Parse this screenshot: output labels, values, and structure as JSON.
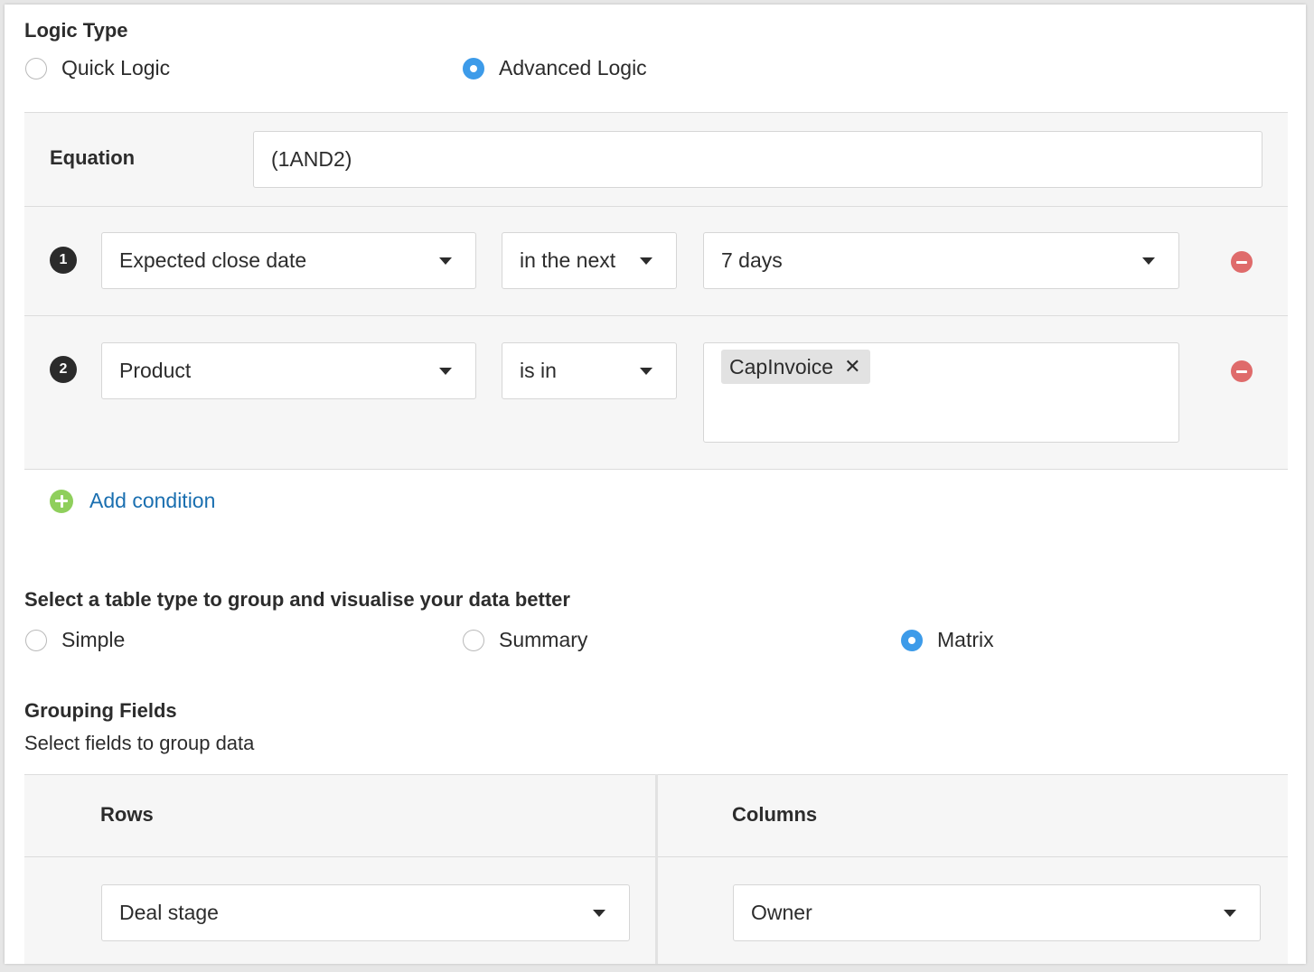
{
  "logic_type": {
    "heading": "Logic Type",
    "options": [
      {
        "label": "Quick Logic",
        "checked": false
      },
      {
        "label": "Advanced Logic",
        "checked": true
      }
    ]
  },
  "equation": {
    "label": "Equation",
    "value": "(1AND2)"
  },
  "conditions": [
    {
      "number": "1",
      "field": "Expected close date",
      "operator": "in the next",
      "value": "7 days"
    },
    {
      "number": "2",
      "field": "Product",
      "operator": "is in",
      "tags": [
        "CapInvoice"
      ]
    }
  ],
  "add_condition_label": "Add condition",
  "table_type": {
    "heading": "Select a table type to group and visualise your data better",
    "options": [
      {
        "label": "Simple",
        "checked": false
      },
      {
        "label": "Summary",
        "checked": false
      },
      {
        "label": "Matrix",
        "checked": true
      }
    ]
  },
  "grouping": {
    "heading": "Grouping Fields",
    "subtext": "Select fields to group data",
    "rows_label": "Rows",
    "columns_label": "Columns",
    "rows_value": "Deal stage",
    "columns_value": "Owner"
  },
  "colors": {
    "radio_checked": "#3d9be9",
    "remove": "#df6b6b",
    "add": "#8fcf5c",
    "link": "#1a6fb0"
  }
}
